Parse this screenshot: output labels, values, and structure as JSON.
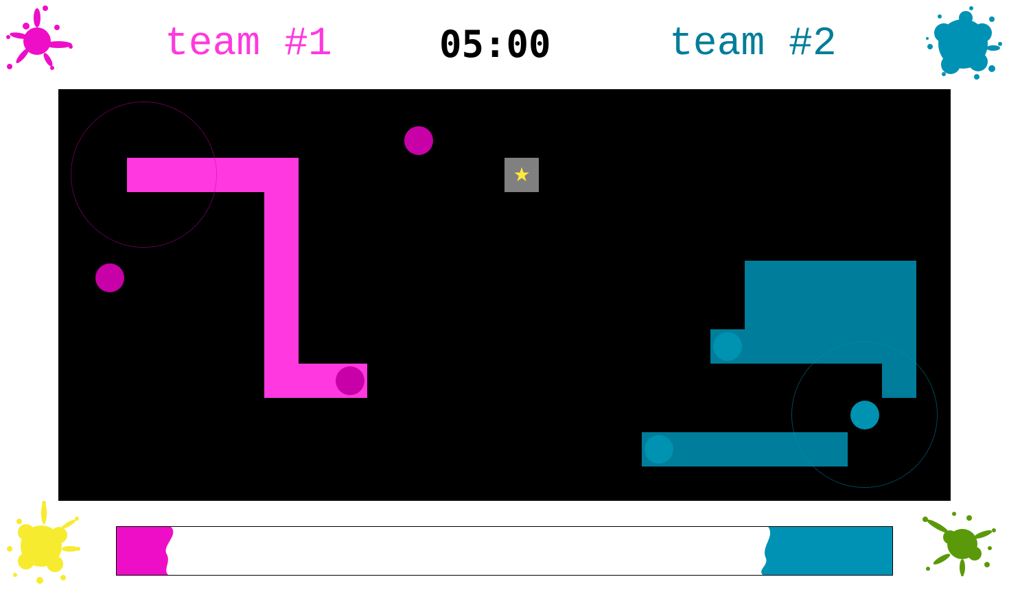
{
  "scoreboard": {
    "team1_name": "team #1",
    "team2_name": "team #2",
    "timer": "05:00"
  },
  "colors": {
    "team1_paint": "#ff38df",
    "team1_player": "#c800a7",
    "team2_paint": "#007d9a",
    "team2_player": "#0092b1",
    "splat_magenta": "#ee0ec8",
    "splat_blue": "#0092b4",
    "splat_yellow": "#f7eb2f",
    "splat_green": "#5a9a0a",
    "powerup_tile": "#808080",
    "powerup_star": "#ffea3a",
    "arena": "#000000"
  },
  "powerup": {
    "icon": "star-icon",
    "glyph": "★"
  },
  "territory": {
    "team1_fraction": 0.07,
    "team2_fraction": 0.16
  }
}
